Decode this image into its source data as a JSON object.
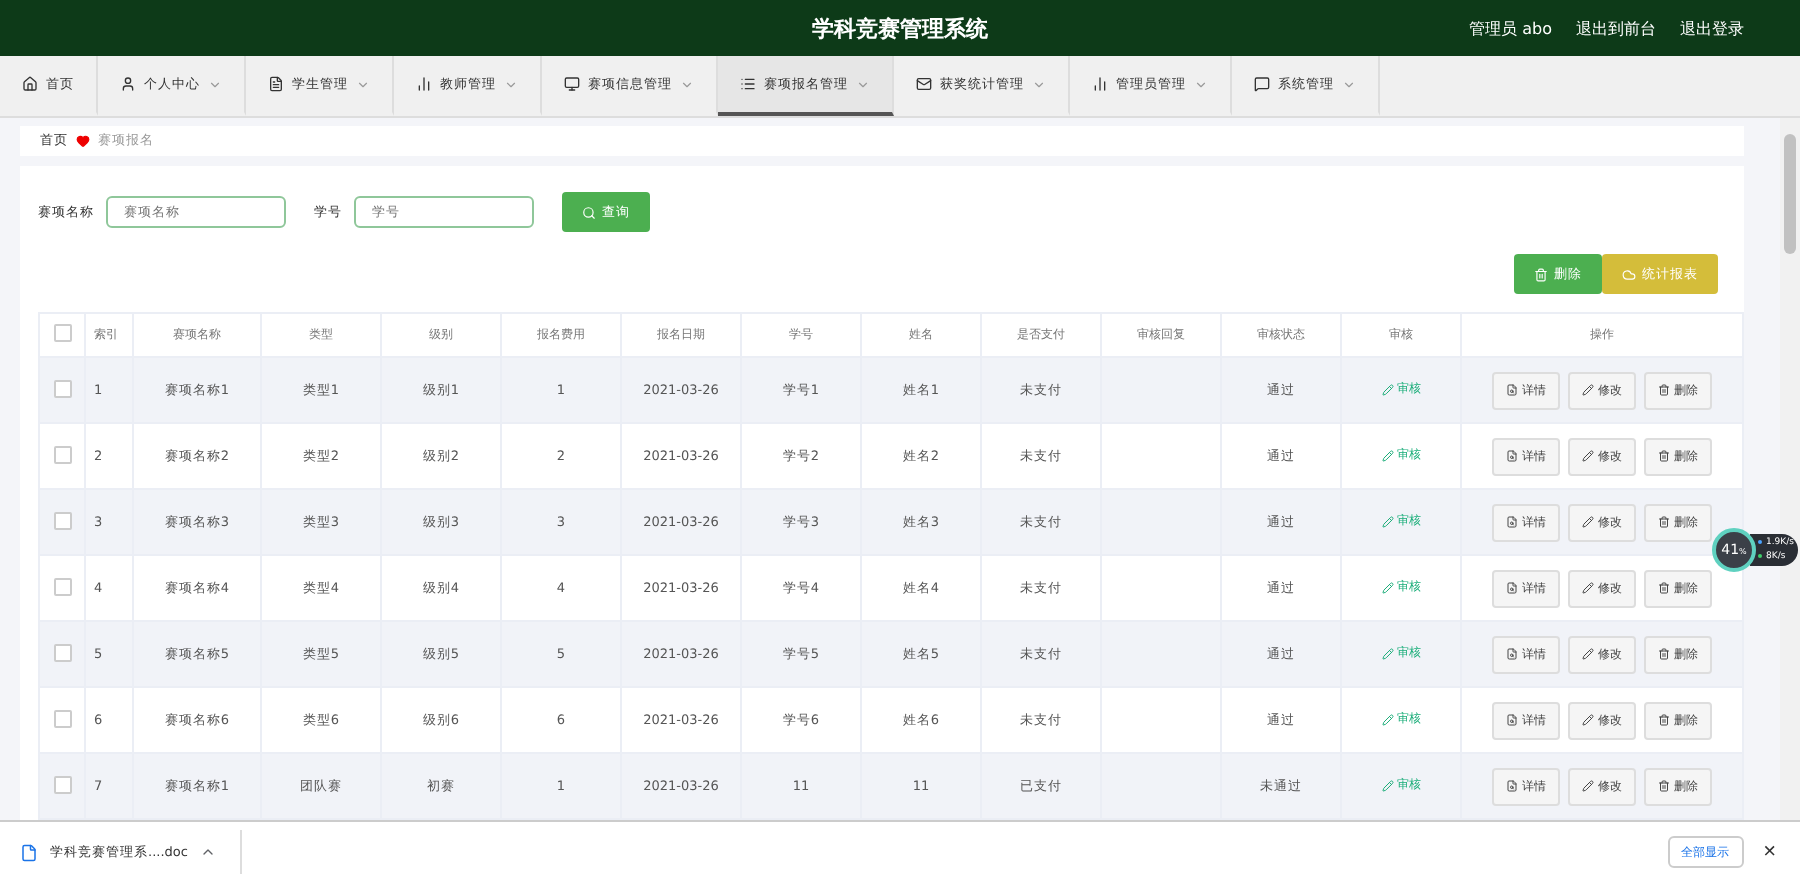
{
  "header": {
    "title": "学科竞赛管理系统",
    "user": "管理员 abo",
    "links": [
      "退出到前台",
      "退出登录"
    ]
  },
  "nav": [
    {
      "label": "首页",
      "dropdown": false,
      "selected": false
    },
    {
      "label": "个人中心",
      "dropdown": true,
      "selected": false
    },
    {
      "label": "学生管理",
      "dropdown": true,
      "selected": false
    },
    {
      "label": "教师管理",
      "dropdown": true,
      "selected": false
    },
    {
      "label": "赛项信息管理",
      "dropdown": true,
      "selected": false
    },
    {
      "label": "赛项报名管理",
      "dropdown": true,
      "selected": true
    },
    {
      "label": "获奖统计管理",
      "dropdown": true,
      "selected": false
    },
    {
      "label": "管理员管理",
      "dropdown": true,
      "selected": false
    },
    {
      "label": "系统管理",
      "dropdown": true,
      "selected": false
    }
  ],
  "breadcrumb": [
    "首页",
    "赛项报名"
  ],
  "search": {
    "fields": [
      {
        "label": "赛项名称",
        "placeholder": "赛项名称"
      },
      {
        "label": "学号",
        "placeholder": "学号"
      }
    ],
    "button": "查询"
  },
  "actions": [
    {
      "label": "删除",
      "kind": "delete"
    },
    {
      "label": "统计报表",
      "kind": "report"
    }
  ],
  "table": {
    "columns": [
      "索引",
      "赛项名称",
      "类型",
      "级别",
      "报名费用",
      "报名日期",
      "学号",
      "姓名",
      "是否支付",
      "审核回复",
      "审核状态",
      "审核",
      "操作"
    ],
    "select_all_checked": false,
    "rows": [
      {
        "checked": false,
        "cells": [
          "1",
          "赛项名称1",
          "类型1",
          "级别1",
          "1",
          "2021-03-26",
          "学号1",
          "姓名1",
          "未支付",
          "",
          "通过"
        ],
        "review": "审核",
        "buttons": [
          "详情",
          "修改",
          "删除"
        ]
      },
      {
        "checked": false,
        "cells": [
          "2",
          "赛项名称2",
          "类型2",
          "级别2",
          "2",
          "2021-03-26",
          "学号2",
          "姓名2",
          "未支付",
          "",
          "通过"
        ],
        "review": "审核",
        "buttons": [
          "详情",
          "修改",
          "删除"
        ]
      },
      {
        "checked": false,
        "cells": [
          "3",
          "赛项名称3",
          "类型3",
          "级别3",
          "3",
          "2021-03-26",
          "学号3",
          "姓名3",
          "未支付",
          "",
          "通过"
        ],
        "review": "审核",
        "buttons": [
          "详情",
          "修改",
          "删除"
        ]
      },
      {
        "checked": false,
        "cells": [
          "4",
          "赛项名称4",
          "类型4",
          "级别4",
          "4",
          "2021-03-26",
          "学号4",
          "姓名4",
          "未支付",
          "",
          "通过"
        ],
        "review": "审核",
        "buttons": [
          "详情",
          "修改",
          "删除"
        ]
      },
      {
        "checked": false,
        "cells": [
          "5",
          "赛项名称5",
          "类型5",
          "级别5",
          "5",
          "2021-03-26",
          "学号5",
          "姓名5",
          "未支付",
          "",
          "通过"
        ],
        "review": "审核",
        "buttons": [
          "详情",
          "修改",
          "删除"
        ]
      },
      {
        "checked": false,
        "cells": [
          "6",
          "赛项名称6",
          "类型6",
          "级别6",
          "6",
          "2021-03-26",
          "学号6",
          "姓名6",
          "未支付",
          "",
          "通过"
        ],
        "review": "审核",
        "buttons": [
          "详情",
          "修改",
          "删除"
        ]
      },
      {
        "checked": false,
        "cells": [
          "7",
          "赛项名称1",
          "团队赛",
          "初赛",
          "1",
          "2021-03-26",
          "11",
          "11",
          "已支付",
          "",
          "未通过"
        ],
        "review": "审核",
        "buttons": [
          "详情",
          "修改",
          "删除"
        ]
      }
    ]
  },
  "speed_widget": {
    "percent": "41",
    "unit": "%",
    "up": "1.9K/s",
    "down": "8K/s"
  },
  "download_bar": {
    "file": "学科竞赛管理系....doc",
    "show_all": "全部显示",
    "close": "×"
  }
}
